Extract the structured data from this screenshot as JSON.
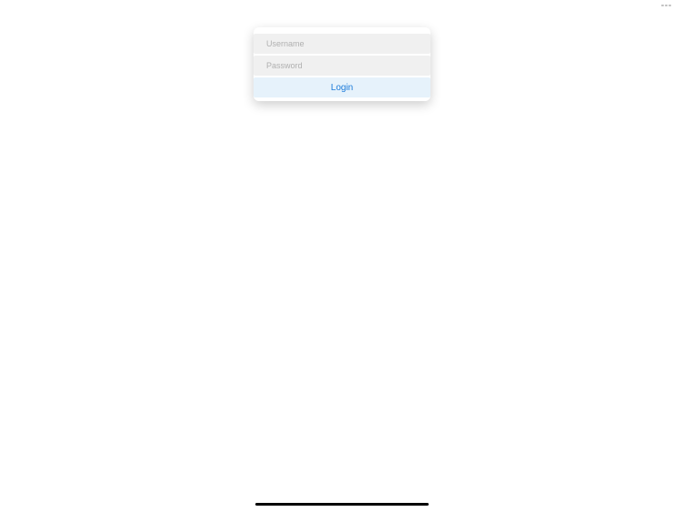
{
  "login": {
    "username_placeholder": "Username",
    "password_placeholder": "Password",
    "button_label": "Login"
  }
}
